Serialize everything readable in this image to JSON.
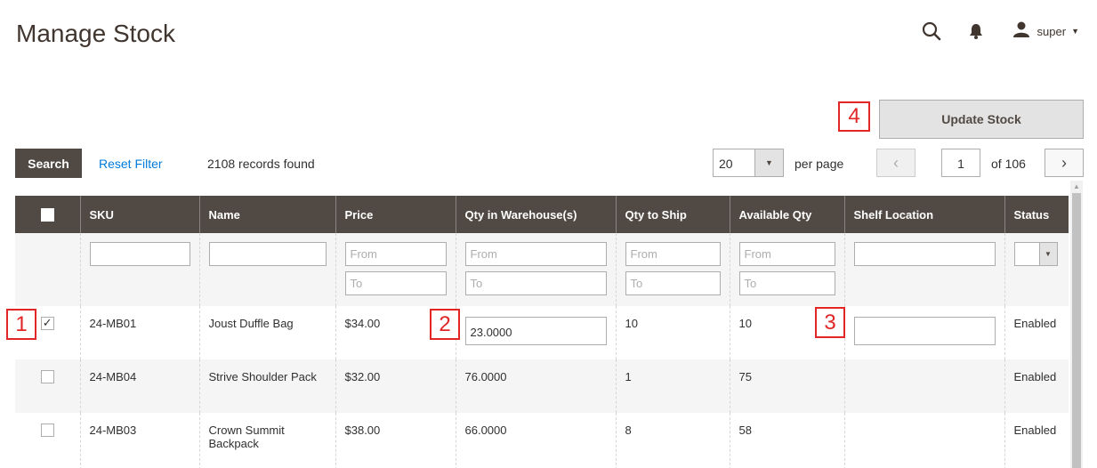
{
  "page": {
    "title": "Manage Stock"
  },
  "header": {
    "user_name": "super"
  },
  "actions": {
    "update_stock": "Update Stock"
  },
  "callouts": [
    "1",
    "2",
    "3",
    "4"
  ],
  "toolbar": {
    "search_label": "Search",
    "reset_label": "Reset Filter",
    "records_found": "2108 records found",
    "per_page_value": "20",
    "per_page_label": "per page",
    "current_page": "1",
    "page_total": "of 106"
  },
  "grid": {
    "columns": [
      "SKU",
      "Name",
      "Price",
      "Qty in Warehouse(s)",
      "Qty to Ship",
      "Available Qty",
      "Shelf Location",
      "Status"
    ],
    "filters": {
      "from_placeholder": "From",
      "to_placeholder": "To"
    },
    "rows": [
      {
        "checked": true,
        "sku": "24-MB01",
        "name": "Joust Duffle Bag",
        "price": "$34.00",
        "qty_warehouse": "23.0000",
        "qty_ship": "10",
        "available": "10",
        "shelf": "",
        "status": "Enabled"
      },
      {
        "checked": false,
        "sku": "24-MB04",
        "name": "Strive Shoulder Pack",
        "price": "$32.00",
        "qty_warehouse": "76.0000",
        "qty_ship": "1",
        "available": "75",
        "shelf": "",
        "status": "Enabled"
      },
      {
        "checked": false,
        "sku": "24-MB03",
        "name": "Crown Summit Backpack",
        "price": "$38.00",
        "qty_warehouse": "66.0000",
        "qty_ship": "8",
        "available": "58",
        "shelf": "",
        "status": "Enabled"
      }
    ]
  },
  "icons": {
    "search": "search-icon",
    "notifications": "bell-icon",
    "user": "user-icon"
  },
  "colors": {
    "header_bg": "#514943",
    "link": "#007bdb",
    "callout": "#e22626"
  }
}
